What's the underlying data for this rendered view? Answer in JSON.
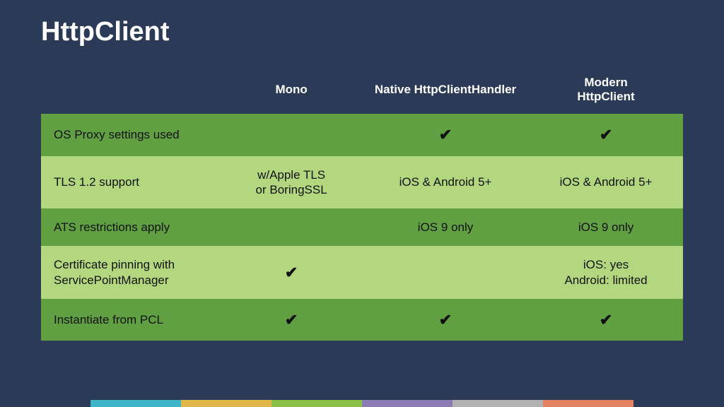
{
  "title": "HttpClient",
  "table": {
    "columns": [
      "",
      "Mono",
      "Native HttpClientHandler",
      "Modern\nHttpClient"
    ],
    "rows": [
      {
        "label": "OS Proxy settings used",
        "cells": [
          "",
          "✔",
          "✔"
        ]
      },
      {
        "label": "TLS 1.2 support",
        "cells": [
          "w/Apple TLS\nor BoringSSL",
          "iOS & Android 5+",
          "iOS & Android 5+"
        ]
      },
      {
        "label": "ATS restrictions apply",
        "cells": [
          "",
          "iOS 9 only",
          "iOS 9 only"
        ]
      },
      {
        "label": "Certificate pinning with\nServicePointManager",
        "cells": [
          "✔",
          "",
          "iOS: yes\nAndroid: limited"
        ]
      },
      {
        "label": "Instantiate from PCL",
        "cells": [
          "✔",
          "✔",
          "✔"
        ]
      }
    ]
  },
  "stripe_colors": [
    "#2b3a56",
    "#3fb6c8",
    "#e2b84b",
    "#8ac04a",
    "#8b7bb7",
    "#b3b3b3",
    "#e0835e",
    "#2b3a56"
  ]
}
